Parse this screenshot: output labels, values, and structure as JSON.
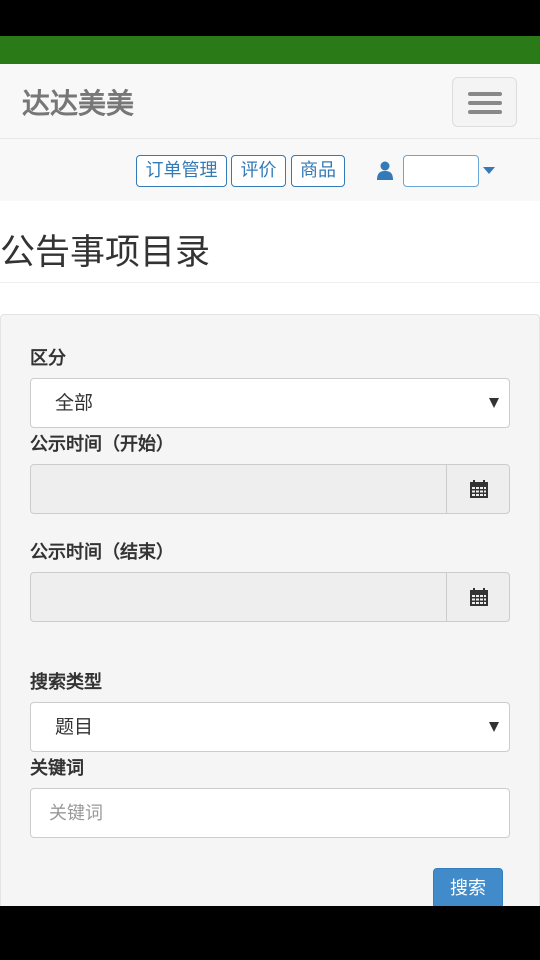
{
  "header": {
    "brand": "达达美美"
  },
  "nav": {
    "buttons": [
      "订单管理",
      "评价",
      "商品"
    ],
    "user_select_value": ""
  },
  "page": {
    "title": "公告事项目录"
  },
  "form": {
    "category": {
      "label": "区分",
      "value": "全部"
    },
    "start_date": {
      "label": "公示时间（开始）",
      "value": ""
    },
    "end_date": {
      "label": "公示时间（结束）",
      "value": ""
    },
    "search_type": {
      "label": "搜索类型",
      "value": "题目"
    },
    "keyword": {
      "label": "关键词",
      "placeholder": "关键词",
      "value": ""
    },
    "search_button": "搜索"
  },
  "colors": {
    "primary": "#337ab7",
    "button": "#428bca",
    "top_bar": "#2a7a17"
  },
  "icons": {
    "user": "user-icon",
    "calendar": "calendar-icon",
    "menu": "hamburger-menu-icon"
  }
}
